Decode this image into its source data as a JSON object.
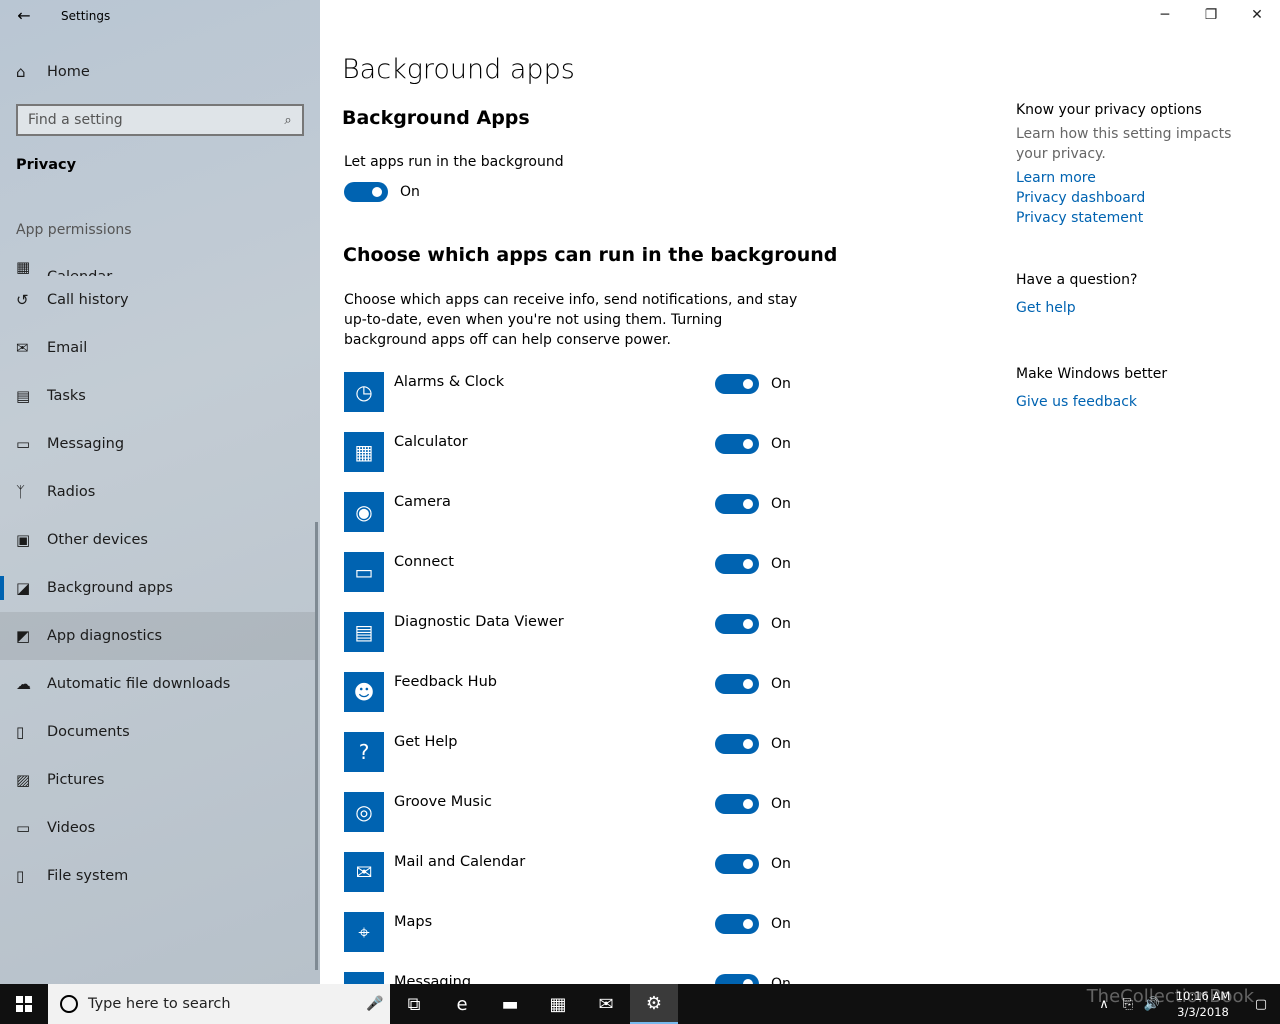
{
  "window": {
    "title": "Settings",
    "controls": {
      "minimize": "─",
      "restore": "❐",
      "close": "✕"
    }
  },
  "sidebar": {
    "back_glyph": "←",
    "home": {
      "icon": "⌂",
      "label": "Home"
    },
    "search": {
      "placeholder": "Find a setting",
      "icon": "⌕"
    },
    "section": "Privacy",
    "group_label": "App permissions",
    "items": [
      {
        "icon": "▦",
        "label": "Calendar",
        "name": "calendar"
      },
      {
        "icon": "↺",
        "label": "Call history",
        "name": "call-history"
      },
      {
        "icon": "✉",
        "label": "Email",
        "name": "email"
      },
      {
        "icon": "▤",
        "label": "Tasks",
        "name": "tasks"
      },
      {
        "icon": "▭",
        "label": "Messaging",
        "name": "messaging"
      },
      {
        "icon": "ᛉ",
        "label": "Radios",
        "name": "radios"
      },
      {
        "icon": "▣",
        "label": "Other devices",
        "name": "other-devices"
      },
      {
        "icon": "◪",
        "label": "Background apps",
        "name": "background-apps",
        "selected": true
      },
      {
        "icon": "◩",
        "label": "App diagnostics",
        "name": "app-diagnostics",
        "hover": true
      },
      {
        "icon": "☁",
        "label": "Automatic file downloads",
        "name": "automatic-file-downloads"
      },
      {
        "icon": "▯",
        "label": "Documents",
        "name": "documents"
      },
      {
        "icon": "▨",
        "label": "Pictures",
        "name": "pictures"
      },
      {
        "icon": "▭",
        "label": "Videos",
        "name": "videos"
      },
      {
        "icon": "▯",
        "label": "File system",
        "name": "file-system"
      }
    ]
  },
  "main": {
    "page_title": "Background apps",
    "sub_title": "Background Apps",
    "master": {
      "label": "Let apps run in the background",
      "state": "On"
    },
    "choose_title": "Choose which apps can run in the background",
    "description": "Choose which apps can receive info, send notifications, and stay up-to-date, even when you're not using them. Turning background apps off can help conserve power.",
    "apps": [
      {
        "name": "Alarms & Clock",
        "icon": "◷",
        "state": "On"
      },
      {
        "name": "Calculator",
        "icon": "▦",
        "state": "On"
      },
      {
        "name": "Camera",
        "icon": "◉",
        "state": "On"
      },
      {
        "name": "Connect",
        "icon": "▭",
        "state": "On"
      },
      {
        "name": "Diagnostic Data Viewer",
        "icon": "▤",
        "state": "On"
      },
      {
        "name": "Feedback Hub",
        "icon": "☻",
        "state": "On"
      },
      {
        "name": "Get Help",
        "icon": "?",
        "state": "On"
      },
      {
        "name": "Groove Music",
        "icon": "◎",
        "state": "On"
      },
      {
        "name": "Mail and Calendar",
        "icon": "✉",
        "state": "On"
      },
      {
        "name": "Maps",
        "icon": "⌖",
        "state": "On"
      },
      {
        "name": "Messaging",
        "icon": "▭",
        "state": "On"
      }
    ]
  },
  "right_panel": {
    "privacy_head": "Know your privacy options",
    "privacy_text": "Learn how this setting impacts your privacy.",
    "links": [
      "Learn more",
      "Privacy dashboard",
      "Privacy statement"
    ],
    "question_head": "Have a question?",
    "help_link": "Get help",
    "better_head": "Make Windows better",
    "feedback_link": "Give us feedback"
  },
  "taskbar": {
    "search_placeholder": "Type here to search",
    "mic_icon": "🎤",
    "pinned": [
      {
        "name": "task-view-icon",
        "glyph": "⧉"
      },
      {
        "name": "edge-icon",
        "glyph": "e"
      },
      {
        "name": "file-explorer-icon",
        "glyph": "▬"
      },
      {
        "name": "store-icon",
        "glyph": "▦"
      },
      {
        "name": "mail-icon",
        "glyph": "✉"
      },
      {
        "name": "settings-icon",
        "glyph": "⚙",
        "active": true
      }
    ],
    "tray_icons": [
      "∧",
      "⎘",
      "🔊"
    ],
    "time": "10:16 AM",
    "date": "3/3/2018",
    "notification_icon": "▢",
    "watermark": "TheCollectionBook"
  },
  "colors": {
    "accent": "#0063b1",
    "taskbar": "#101010"
  }
}
